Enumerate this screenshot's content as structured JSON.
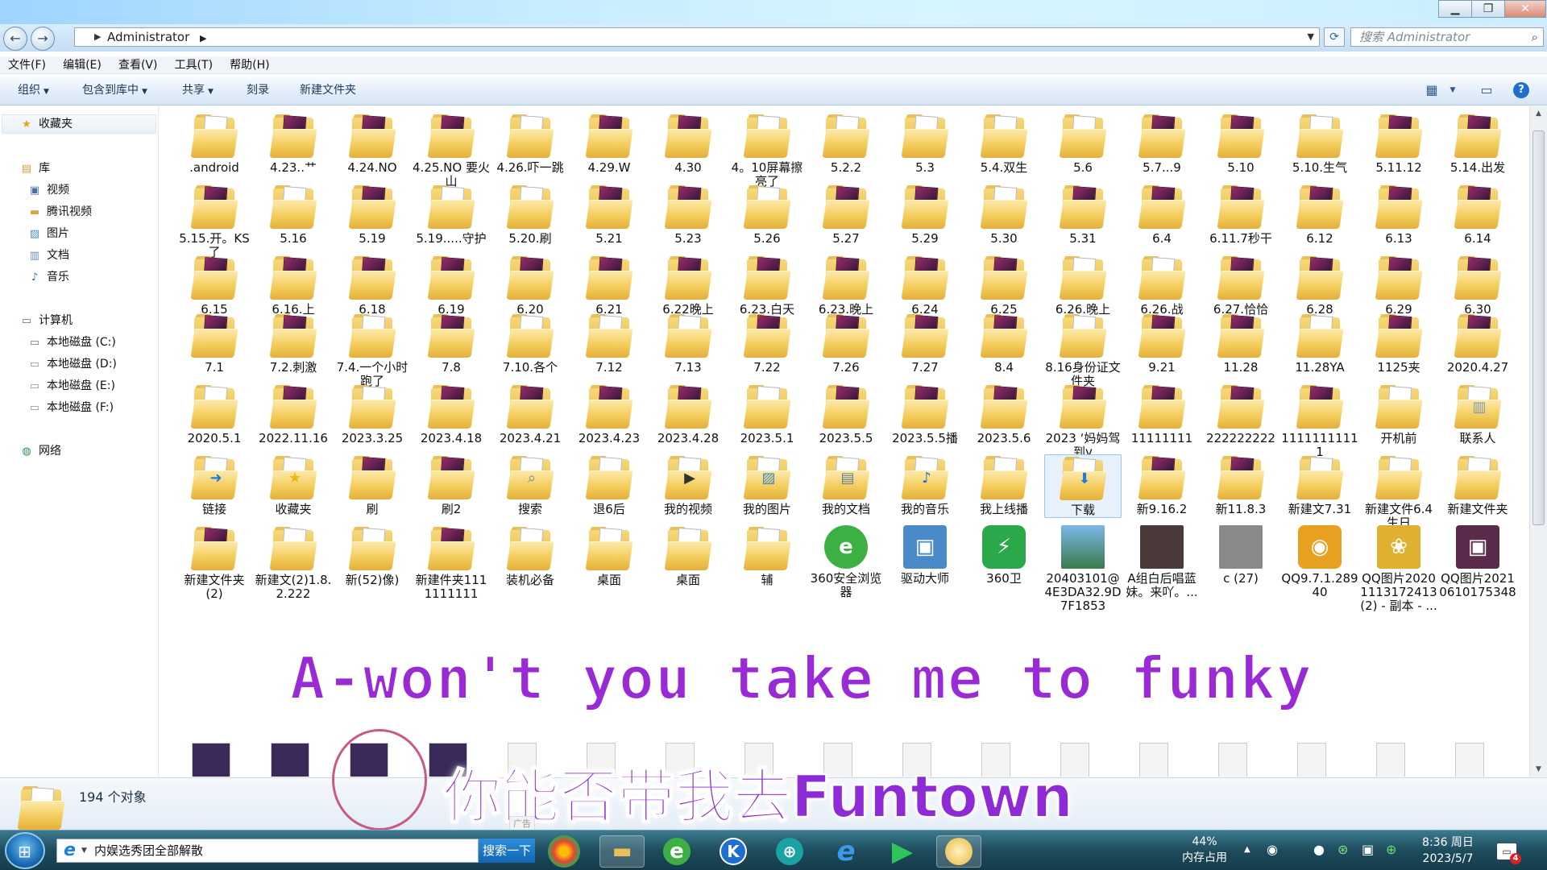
{
  "window": {
    "address": "Administrator",
    "search_placeholder": "搜索 Administrator"
  },
  "menu": [
    "文件(F)",
    "编辑(E)",
    "查看(V)",
    "工具(T)",
    "帮助(H)"
  ],
  "commands": [
    "组织",
    "包含到库中",
    "共享",
    "刻录",
    "新建文件夹"
  ],
  "nav": {
    "favorites": "收藏夹",
    "library": "库",
    "library_items": [
      "视频",
      "腾讯视频",
      "图片",
      "文档",
      "音乐"
    ],
    "computer": "计算机",
    "drives": [
      "本地磁盘 (C:)",
      "本地磁盘 (D:)",
      "本地磁盘 (E:)",
      "本地磁盘 (F:)"
    ],
    "network": "网络"
  },
  "rows": [
    [
      ".android",
      "4.23..艹",
      "4.24.NO",
      "4.25.NO 要火山",
      "4.26.吓一跳",
      "4.29.W",
      "4.30",
      "4。10屏幕擦亮了",
      "5.2.2",
      "5.3",
      "5.4.双生",
      "5.6",
      "5.7...9",
      "5.10",
      "5.10.生气",
      "5.11.12",
      "5.14.出发"
    ],
    [
      "5.15.开。KS了",
      "5.16",
      "5.19",
      "5.19.....守护",
      "5.20.刷",
      "5.21",
      "5.23",
      "5.26",
      "5.27",
      "5.29",
      "5.30",
      "5.31",
      "6.4",
      "6.11.7秒干",
      "6.12",
      "6.13",
      "6.14"
    ],
    [
      "6.15",
      "6.16.上",
      "6.18",
      "6.19",
      "6.20",
      "6.21",
      "6.22晚上",
      "6.23.白天",
      "6.23.晚上",
      "6.24",
      "6.25",
      "6.26.晚上",
      "6.26.战",
      "6.27.恰恰",
      "6.28",
      "6.29",
      "6.30"
    ],
    [
      "7.1",
      "7.2.刺激",
      "7.4.一个小时跑了",
      "7.8",
      "7.10.各个",
      "7.12",
      "7.13",
      "7.22",
      "7.26",
      "7.27",
      "8.4",
      "8.16身份证文件夹",
      "9.21",
      "11.28",
      "11.28YA",
      "1125夹",
      "2020.4.27"
    ],
    [
      "2020.5.1",
      "2022.11.16",
      "2023.3.25",
      "2023.4.18",
      "2023.4.21",
      "2023.4.23",
      "2023.4.28",
      "2023.5.1",
      "2023.5.5",
      "2023.5.5播",
      "2023.5.6",
      "2023 ‘妈妈驾到v",
      "11111111",
      "222222222",
      "11111111111",
      "开机前",
      "联系人"
    ],
    [
      "链接",
      "收藏夹",
      "刷",
      "刷2",
      "搜索",
      "退6后",
      "我的视频",
      "我的图片",
      "我的文档",
      "我的音乐",
      "我上线播",
      "下载",
      "新9.16.2",
      "新11.8.3",
      "新建文7.31",
      "新建文件6.4生日",
      "新建文件夹"
    ],
    [
      "新建文件夹(2)",
      "新建文(2)1.8.2.222",
      "新(52)像)",
      "新建件夹1111111111",
      "装机必备",
      "桌面",
      "桌面",
      "辅",
      "360安全浏览器",
      "驱动大师",
      "360卫",
      "20403101@4E3DA32.9D7F1853",
      "A组白后唱蓝妹。来吖。...",
      "c (27)",
      "QQ9.7.1.28940",
      "QQ图片20201113172413 (2) - 副本 - ...",
      "QQ图片20210610175348"
    ]
  ],
  "selected_item": "下载",
  "status": {
    "count": "194 个对象"
  },
  "subtitles": {
    "english": "A-won't you take me to funky",
    "chinese": "你能否带我去Funtown"
  },
  "ad_label": "广告",
  "taskbar": {
    "ie_text": "内娱选秀团全部解散",
    "search_button": "搜索一下",
    "memory_percent": "44%",
    "memory_label": "内存占用",
    "time": "8:36 周日",
    "date": "2023/5/7",
    "notification_count": "4"
  },
  "colors": {
    "subtitle": "#8f2bd6",
    "selection": "#e6f1fc",
    "taskbar": "#1d4c5d"
  }
}
